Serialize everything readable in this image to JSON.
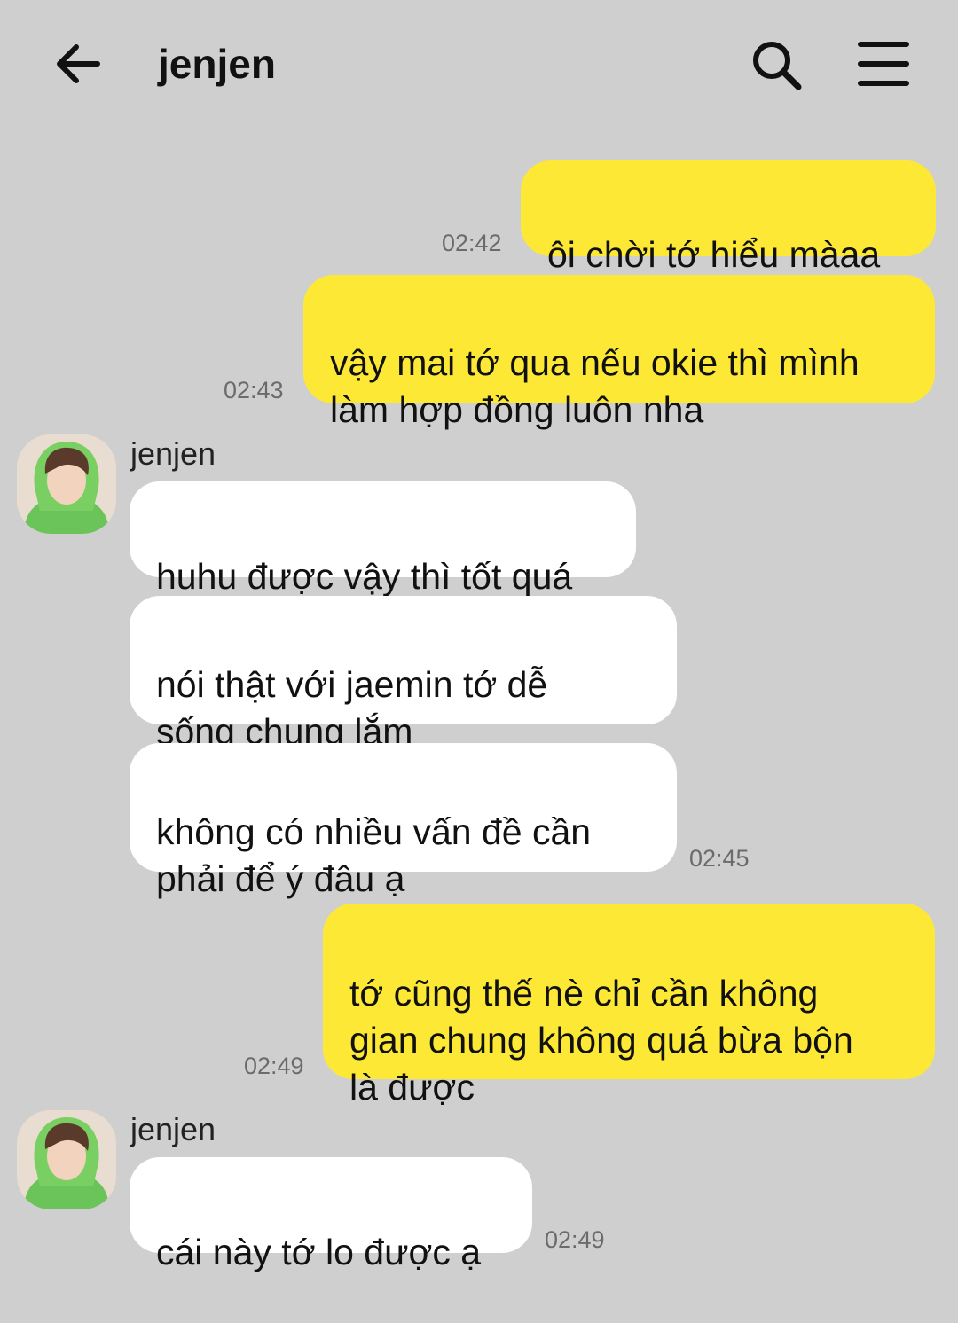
{
  "header": {
    "title": "jenjen",
    "back_icon": "arrow-left-icon",
    "search_icon": "search-icon",
    "menu_icon": "hamburger-menu-icon"
  },
  "colors": {
    "background": "#cfcfcf",
    "my_bubble": "#fde935",
    "their_bubble": "#ffffff",
    "timestamp": "#6b6b6b"
  },
  "messages": [
    {
      "from": "me",
      "text": "ôi chời tớ hiểu màaa",
      "time": "02:42"
    },
    {
      "from": "me",
      "text": "vậy mai tớ qua nếu okie thì mình\nlàm hợp đồng luôn nha",
      "time": "02:43"
    },
    {
      "from": "jenjen",
      "sender": "jenjen",
      "text": "huhu được vậy thì tốt quá"
    },
    {
      "from": "jenjen",
      "text": "nói thật với jaemin tớ dễ\nsống chung lắm"
    },
    {
      "from": "jenjen",
      "text": "không có nhiều vấn đề cần\nphải để ý đâu ạ",
      "time": "02:45"
    },
    {
      "from": "me",
      "text": "tớ cũng thế nè chỉ cần không\ngian chung không quá bừa bộn\nlà được",
      "time": "02:49"
    },
    {
      "from": "jenjen",
      "sender": "jenjen",
      "text": "cái này tớ lo được ạ",
      "time": "02:49"
    }
  ]
}
